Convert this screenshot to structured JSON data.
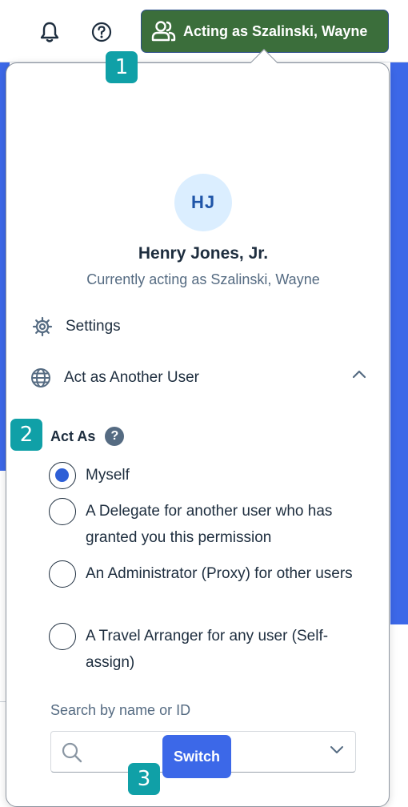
{
  "header": {
    "acting_button_label": "Acting as Szalinski, Wayne"
  },
  "badges": [
    "1",
    "2",
    "3"
  ],
  "profile": {
    "initials": "HJ",
    "name": "Henry Jones, Jr.",
    "acting_status": "Currently acting as Szalinski, Wayne"
  },
  "menu": {
    "settings_label": "Settings",
    "act_as_another_label": "Act as Another User"
  },
  "act_as": {
    "title": "Act As",
    "help_glyph": "?",
    "options": [
      {
        "label": "Myself",
        "selected": true
      },
      {
        "label": "A Delegate for another user who has granted you this permission",
        "selected": false
      },
      {
        "label": "An Administrator (Proxy) for other users",
        "selected": false
      },
      {
        "label": "A Travel Arranger for any user (Self-assign)",
        "selected": false
      }
    ]
  },
  "search": {
    "label": "Search by name or ID",
    "value": "",
    "placeholder": ""
  },
  "switch_label": "Switch",
  "colors": {
    "acting_button_bg": "#3b6e3b",
    "primary_blue": "#3c68e8",
    "badge_teal": "#10a0a7",
    "avatar_bg": "#dbeeff"
  },
  "icons": {
    "notifications": "bell-icon",
    "help": "help-circle-icon",
    "acting": "users-icon",
    "settings": "gear-icon",
    "act_as": "globe-icon",
    "collapse": "chevron-up-icon",
    "search": "search-icon",
    "dropdown": "chevron-down-icon"
  }
}
